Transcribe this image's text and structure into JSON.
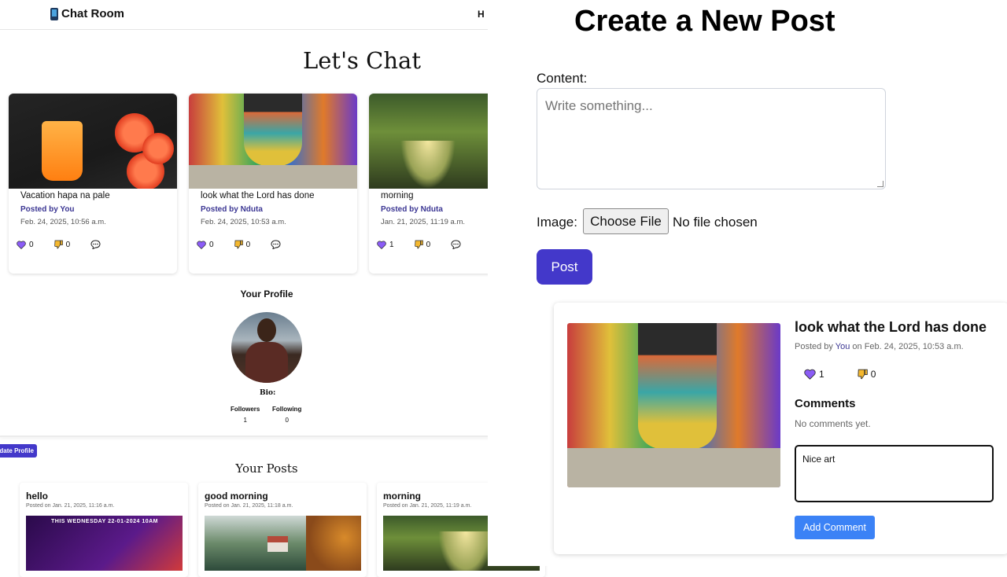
{
  "navbar": {
    "brand": "Chat Room",
    "cut_link": "H"
  },
  "main": {
    "heading": "Let's Chat"
  },
  "feed": [
    {
      "title": "Vacation hapa na pale",
      "author": "Posted by You",
      "date": "Feb. 24, 2025, 10:56 a.m.",
      "likes": "0",
      "dislikes": "0"
    },
    {
      "title": "look what the Lord has done",
      "author": "Posted by Nduta",
      "date": "Feb. 24, 2025, 10:53 a.m.",
      "likes": "0",
      "dislikes": "0"
    },
    {
      "title": "morning",
      "author": "Posted by Nduta",
      "date": "Jan. 21, 2025, 11:19 a.m.",
      "likes": "1",
      "dislikes": "0"
    }
  ],
  "profile": {
    "title": "Your Profile",
    "bio_label": "Bio:",
    "followers_label": "Followers",
    "followers": "1",
    "following_label": "Following",
    "following": "0",
    "update_button": "date Profile"
  },
  "your_posts": {
    "title": "Your Posts",
    "items": [
      {
        "title": "hello",
        "date": "Posted on Jan. 21, 2025, 11:16 a.m.",
        "image_text": "THIS WEDNESDAY 22-01-2024  10AM"
      },
      {
        "title": "good morning",
        "date": "Posted on Jan. 21, 2025, 11:18 a.m."
      },
      {
        "title": "morning",
        "date": "Posted on Jan. 21, 2025, 11:19 a.m."
      }
    ]
  },
  "create": {
    "title": "Create a New Post",
    "content_label": "Content:",
    "content_placeholder": "Write something...",
    "image_label": "Image:",
    "choose_file": "Choose File",
    "no_file": "No file chosen",
    "post_button": "Post"
  },
  "detail": {
    "title": "look what the Lord has done",
    "meta_prefix": "Posted by ",
    "meta_author": "You",
    "meta_suffix": " on Feb. 24, 2025, 10:53 a.m.",
    "likes": "1",
    "dislikes": "0",
    "comments_heading": "Comments",
    "no_comments": "No comments yet.",
    "comment_value": "Nice art ",
    "add_comment_button": "Add Comment"
  },
  "colors": {
    "brand_purple": "#4338ca",
    "author_purple": "#3b3693",
    "add_comment_blue": "#3b82f6",
    "heart": "#8b5cf6",
    "thumbs_down": "#f5b82e"
  },
  "icons": [
    "phone-icon",
    "heart-icon",
    "thumbs-down-icon",
    "comment-icon"
  ]
}
